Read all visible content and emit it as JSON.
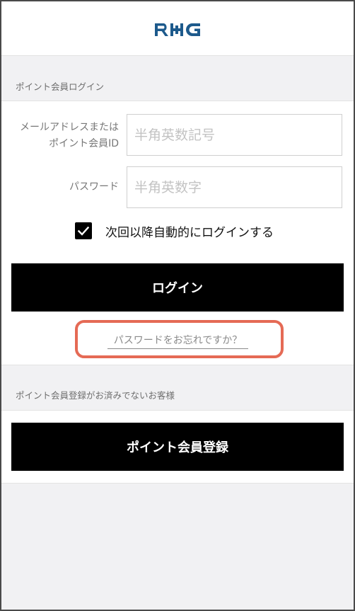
{
  "header": {
    "logo_text": "RHG",
    "logo_color": "#1d5a8c"
  },
  "login_section": {
    "title": "ポイント会員ログイン",
    "email_label_line1": "メールアドレスまたは",
    "email_label_line2": "ポイント会員ID",
    "email_placeholder": "半角英数記号",
    "email_value": "",
    "password_label": "パスワード",
    "password_placeholder": "半角英数字",
    "password_value": "",
    "remember_label": "次回以降自動的にログインする",
    "remember_checked": true,
    "login_button": "ログイン",
    "forgot_link": "パスワードをお忘れですか？",
    "highlight_color": "#e56a55"
  },
  "register_section": {
    "title": "ポイント会員登録がお済みでないお客様",
    "register_button": "ポイント会員登録"
  }
}
